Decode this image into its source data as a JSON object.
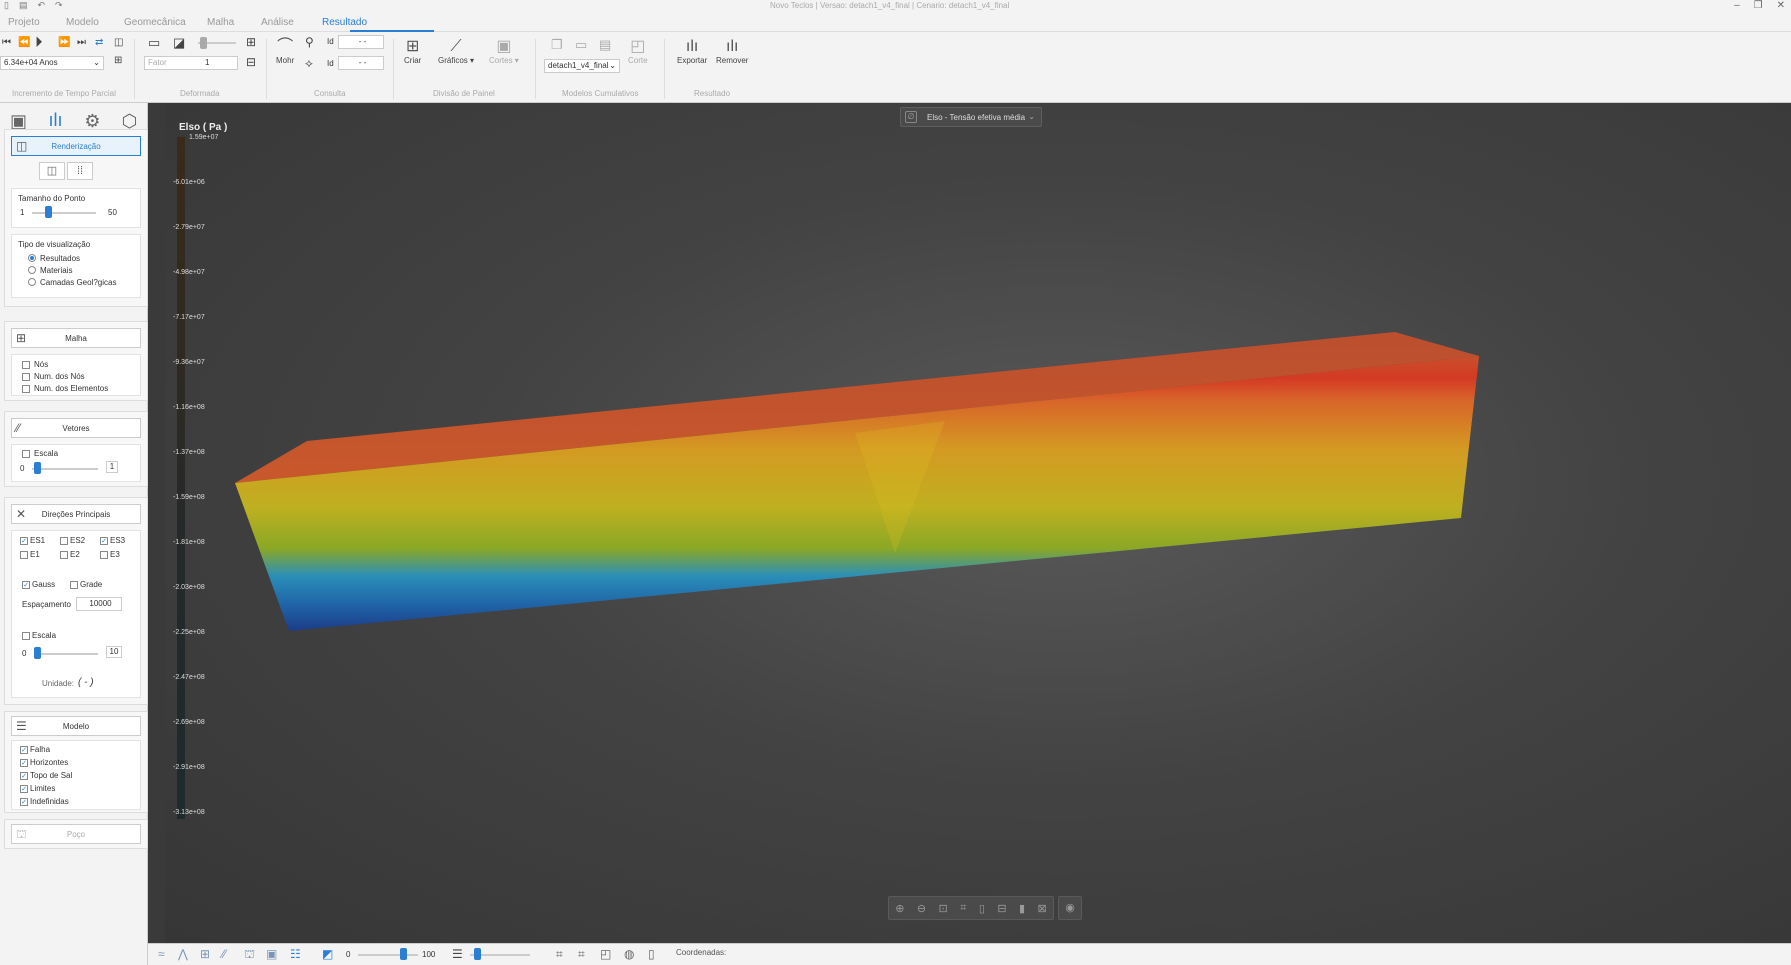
{
  "titlebar": {
    "title": "Novo Teclos | Versao: detach1_v4_final | Cenario: detach1_v4_final"
  },
  "menu": [
    "Projeto",
    "Modelo",
    "Geomecânica",
    "Malha",
    "Análise",
    "Resultado"
  ],
  "ribbon": {
    "time_value": "6.34e+04 Anos",
    "group_time": "Incremento de Tempo Parcial",
    "fator_placeholder": "Fator",
    "fator_value": "1",
    "group_deform": "Deformada",
    "mohr": "Mohr",
    "id1_label": "Id",
    "id1_value": "- -",
    "id2_label": "Id",
    "id2_value": "- -",
    "group_consulta": "Consulta",
    "criar": "Criar",
    "graficos": "Gráficos",
    "cortes": "Cortes",
    "group_painel": "Divisão de Painel",
    "model_select": "detach1_v4_final",
    "corte": "Corte",
    "group_cumul": "Modelos Cumulativos",
    "exportar": "Exportar",
    "remover": "Remover",
    "group_result": "Resultado"
  },
  "panel": {
    "render_btn": "Renderização",
    "point_size_label": "Tamanho do Ponto",
    "point_min": "1",
    "point_max": "50",
    "point_value": 0.25,
    "vis_type_label": "Tipo de visualização",
    "vis_options": [
      "Resultados",
      "Materiais",
      "Camadas Geol?gicas"
    ],
    "malha_btn": "Malha",
    "malha_opts": [
      "Nós",
      "Num. dos Nós",
      "Num. dos Elementos"
    ],
    "vetores_btn": "Vetores",
    "escala1": "Escala",
    "vet_min": "0",
    "vet_max": "1",
    "dir_btn": "Direções Principais",
    "es1": "ES1",
    "es2": "ES2",
    "es3": "ES3",
    "e1": "E1",
    "e2": "E2",
    "e3": "E3",
    "gauss": "Gauss",
    "grade": "Grade",
    "espacamento_label": "Espaçamento",
    "espacamento_value": "10000",
    "escala2": "Escala",
    "dir_min": "0",
    "dir_max": "10",
    "unidade": "Unidade:",
    "unidade_val": "( - )",
    "modelo_btn": "Modelo",
    "modelo_opts": [
      "Falha",
      "Horizontes",
      "Topo de Sal",
      "Limites",
      "Indefinidas"
    ],
    "poco_btn": "Poço"
  },
  "viewport": {
    "result_select": "Elso - Tensão efetiva média",
    "colorbar_title": "Elso ( Pa )",
    "ticks": [
      "1.59e+07",
      "-6.01e+06",
      "-2.79e+07",
      "-4.98e+07",
      "-7.17e+07",
      "-9.36e+07",
      "-1.16e+08",
      "-1.37e+08",
      "-1.59e+08",
      "-1.81e+08",
      "-2.03e+08",
      "-2.25e+08",
      "-2.47e+08",
      "-2.69e+08",
      "-2.91e+08",
      "-3.13e+08"
    ]
  },
  "bottombar": {
    "opacity_min": "0",
    "opacity_max": "100",
    "coords_label": "Coordenadas:"
  }
}
